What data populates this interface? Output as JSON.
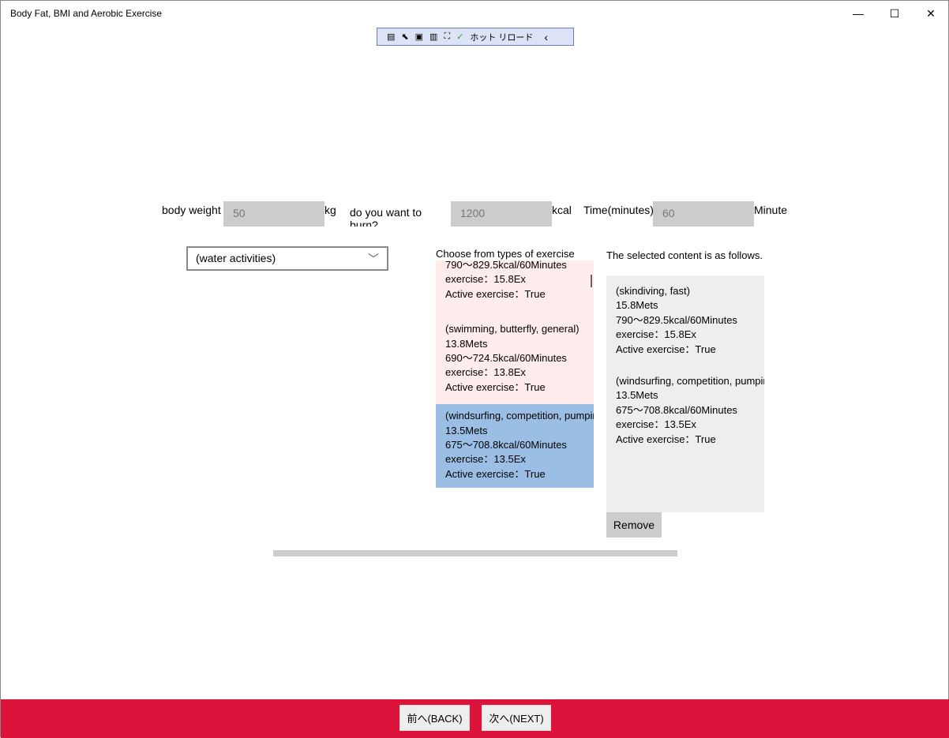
{
  "window": {
    "title": "Body Fat, BMI and Aerobic Exercise",
    "minimize": "—",
    "maximize": "☐",
    "close": "✕"
  },
  "devtoolbar": {
    "hot_reload": "ホット リロード",
    "collapse": "‹"
  },
  "form": {
    "weight_label": "body weight",
    "weight_value": "50",
    "weight_unit": "kg",
    "kcal_label_lines": [
      "do you want to",
      "burn?"
    ],
    "kcal_value": "1200",
    "kcal_unit": "kcal",
    "time_label": "Time(minutes)",
    "time_value": "60",
    "time_unit": "Minute"
  },
  "category": {
    "selected": "(water activities)"
  },
  "exercise_list": {
    "heading": "Choose from types of exercise",
    "items": [
      {
        "lines": [
          "790〜829.5kcal/60Minutes",
          "exercise：15.8Ex",
          "Active exercise：True"
        ],
        "selected": false
      },
      {
        "lines": [
          "(swimming, butterfly, general)",
          "13.8Mets",
          "690〜724.5kcal/60Minutes",
          "exercise：13.8Ex",
          "Active exercise：True"
        ],
        "selected": false
      },
      {
        "lines": [
          "(windsurfing, competition, pumping)",
          "13.5Mets",
          "675〜708.8kcal/60Minutes",
          "exercise：13.5Ex",
          "Active exercise：True"
        ],
        "selected": true
      }
    ]
  },
  "selected_content": {
    "heading": "The selected content is as follows.",
    "items": [
      {
        "lines": [
          "(skindiving, fast)",
          "15.8Mets",
          "790〜829.5kcal/60Minutes",
          "exercise：15.8Ex",
          "Active exercise：True"
        ]
      },
      {
        "lines": [
          "(windsurfing, competition, pumping)",
          "13.5Mets",
          "675〜708.8kcal/60Minutes",
          "exercise：13.5Ex",
          "Active exercise：True"
        ]
      }
    ],
    "remove_label": "Remove"
  },
  "nav": {
    "back": "前へ(BACK)",
    "next": "次へ(NEXT)"
  },
  "colors": {
    "footer": "#dc143c",
    "list_bg": "#fdeceb",
    "list_selected": "#9bbfe4"
  }
}
